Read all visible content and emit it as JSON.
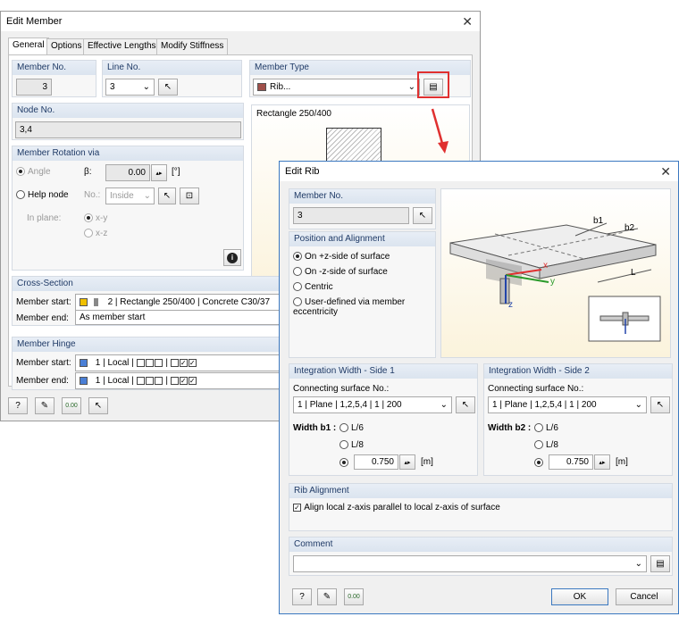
{
  "edit_member": {
    "title": "Edit Member",
    "tabs": [
      "General",
      "Options",
      "Effective Lengths",
      "Modify Stiffness"
    ],
    "member_no": {
      "header": "Member No.",
      "value": "3"
    },
    "line_no": {
      "header": "Line No.",
      "value": "3"
    },
    "member_type": {
      "header": "Member Type",
      "value": "Rib..."
    },
    "node_no": {
      "header": "Node No.",
      "value": "3,4"
    },
    "preview_label": "Rectangle 250/400",
    "rotation": {
      "header": "Member Rotation via",
      "angle_label": "Angle",
      "beta_label": "β:",
      "beta_value": "0.00",
      "beta_unit": "[°]",
      "help_node_label": "Help node",
      "no_label": "No.:",
      "no_value": "Inside",
      "in_plane_label": "In plane:",
      "xy": "x-y",
      "xz": "x-z"
    },
    "cross_section": {
      "header": "Cross-Section",
      "start_label": "Member start:",
      "start_no": "2",
      "start_name": "Rectangle 250/400",
      "start_mat": "Concrete C30/37",
      "end_label": "Member end:",
      "end_value": "As member start"
    },
    "hinge": {
      "header": "Member Hinge",
      "start_label": "Member start:",
      "start_no": "1",
      "start_sys": "Local",
      "end_label": "Member end:",
      "end_no": "1",
      "end_sys": "Local"
    }
  },
  "edit_rib": {
    "title": "Edit Rib",
    "member_no": {
      "header": "Member No.",
      "value": "3"
    },
    "position": {
      "header": "Position and Alignment",
      "opt1": "On +z-side of surface",
      "opt2": "On -z-side of surface",
      "opt3": "Centric",
      "opt4": "User-defined via member eccentricity"
    },
    "figure": {
      "b1": "b1",
      "b2": "b2",
      "L": "L",
      "x": "x",
      "y": "y",
      "z": "z"
    },
    "side1": {
      "header": "Integration Width - Side 1",
      "conn_label": "Connecting surface No.:",
      "conn_value": "1 | Plane | 1,2,5,4 | 1 | 200",
      "width_label": "Width b1 :",
      "opt1": "L/6",
      "opt2": "L/8",
      "value": "0.750",
      "unit": "[m]"
    },
    "side2": {
      "header": "Integration Width - Side 2",
      "conn_label": "Connecting surface No.:",
      "conn_value": "1 | Plane | 1,2,5,4 | 1 | 200",
      "width_label": "Width b2 :",
      "opt1": "L/6",
      "opt2": "L/8",
      "value": "0.750",
      "unit": "[m]"
    },
    "rib_alignment": {
      "header": "Rib Alignment",
      "check_label": "Align local z-axis parallel to local z-axis of surface"
    },
    "comment": {
      "header": "Comment",
      "value": ""
    },
    "ok": "OK",
    "cancel": "Cancel"
  },
  "colors": {
    "accent": "#e03030",
    "section": "#f0c000",
    "hinge": "#4a7fd6",
    "rib": "#a0504a"
  }
}
